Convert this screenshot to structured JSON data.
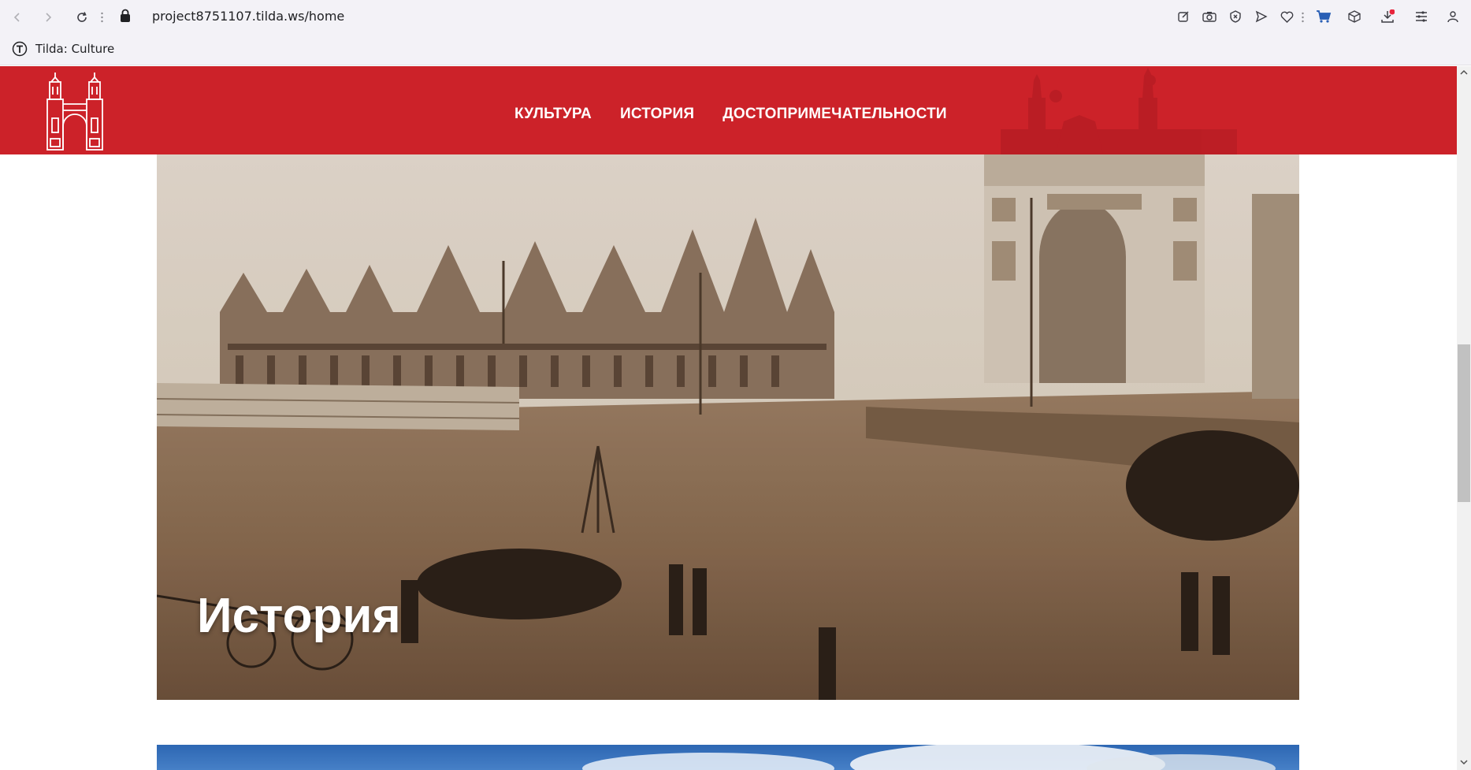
{
  "browser": {
    "url": "project8751107.tilda.ws/home",
    "tab_title": "Tilda: Culture",
    "nav_icons": [
      "back-icon",
      "forward-icon",
      "reload-icon"
    ],
    "toolbar_icons": [
      "edit-icon",
      "camera-icon",
      "shield-icon",
      "send-icon",
      "heart-icon",
      "cart-icon",
      "box-icon",
      "download-icon",
      "menu-icon",
      "profile-icon"
    ]
  },
  "site": {
    "brand_color": "#cc2229",
    "menu": [
      {
        "label": "КУЛЬТУРА"
      },
      {
        "label": "ИСТОРИЯ"
      },
      {
        "label": "ДОСТОПРИМЕЧАТЕЛЬНОСТИ"
      }
    ],
    "hero": {
      "title": "История"
    }
  }
}
